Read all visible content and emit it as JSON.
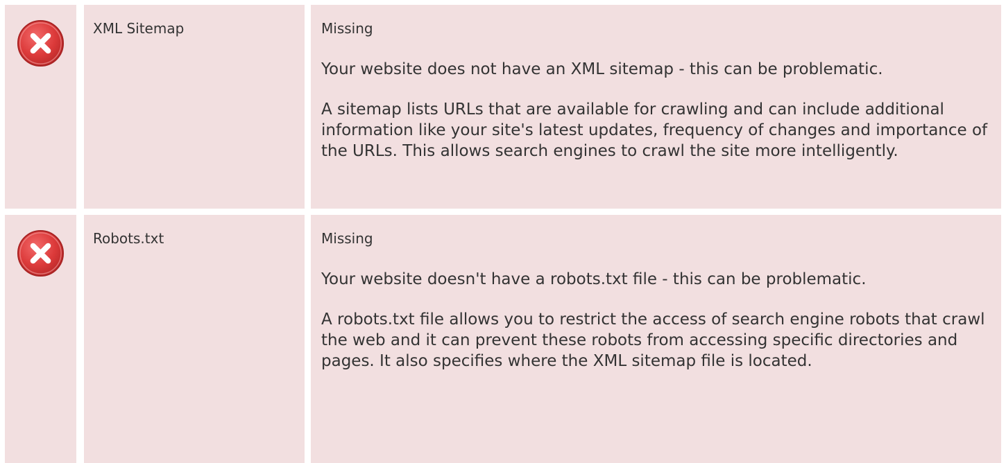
{
  "checks": [
    {
      "name": "XML Sitemap",
      "icon": "error-x-icon",
      "status": "Missing",
      "summary": "Your website does not have an XML sitemap - this can be problematic.",
      "description": "A sitemap lists URLs that are available for crawling and can include additional information like your site's latest updates, frequency of changes and importance of the URLs. This allows search engines to crawl the site more intelligently."
    },
    {
      "name": "Robots.txt",
      "icon": "error-x-icon",
      "status": "Missing",
      "summary": "Your website doesn't have a robots.txt file - this can be problematic.",
      "description": "A robots.txt file allows you to restrict the access of search engine robots that crawl the web and it can prevent these robots from accessing specific directories and pages. It also specifies where the XML sitemap file is located."
    }
  ],
  "colors": {
    "row_background": "#f2dfe0",
    "error_red": "#dc3a3a",
    "text": "#333333"
  }
}
